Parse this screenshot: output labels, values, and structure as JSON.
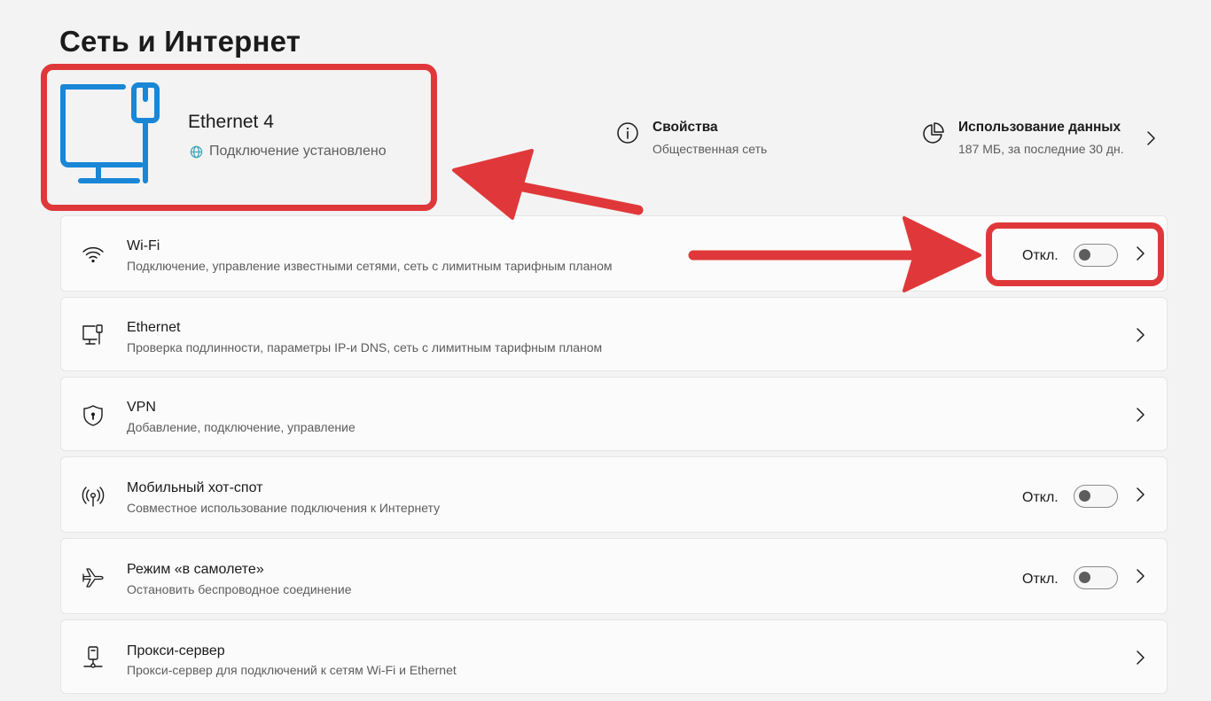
{
  "page": {
    "title": "Сеть и Интернет"
  },
  "connection": {
    "name": "Ethernet 4",
    "status": "Подключение установлено",
    "icon": "monitor-ethernet-icon"
  },
  "properties": {
    "title": "Свойства",
    "subtitle": "Общественная сеть",
    "icon": "info-icon"
  },
  "data_usage": {
    "title": "Использование данных",
    "subtitle": "187 МБ, за последние 30 дн.",
    "icon": "pie-chart-icon"
  },
  "items": [
    {
      "id": "wifi",
      "title": "Wi-Fi",
      "subtitle": "Подключение, управление известными сетями, сеть с лимитным тарифным планом",
      "toggle_label": "Откл.",
      "toggle_on": false,
      "icon": "wifi-icon"
    },
    {
      "id": "ethernet",
      "title": "Ethernet",
      "subtitle": "Проверка подлинности, параметры IP-и DNS, сеть с лимитным тарифным планом",
      "icon": "ethernet-icon"
    },
    {
      "id": "vpn",
      "title": "VPN",
      "subtitle": "Добавление, подключение, управление",
      "icon": "shield-icon"
    },
    {
      "id": "hotspot",
      "title": "Мобильный хот-спот",
      "subtitle": "Совместное использование подключения к Интернету",
      "toggle_label": "Откл.",
      "toggle_on": false,
      "icon": "hotspot-icon"
    },
    {
      "id": "airplane",
      "title": "Режим «в самолете»",
      "subtitle": "Остановить беспроводное соединение",
      "toggle_label": "Откл.",
      "toggle_on": false,
      "icon": "airplane-icon"
    },
    {
      "id": "proxy",
      "title": "Прокси-сервер",
      "subtitle": "Прокси-сервер для подключений к сетям Wi-Fi и Ethernet",
      "icon": "proxy-icon"
    }
  ],
  "colors": {
    "accent": "#1a86d6",
    "annotation": "#e0383a"
  }
}
